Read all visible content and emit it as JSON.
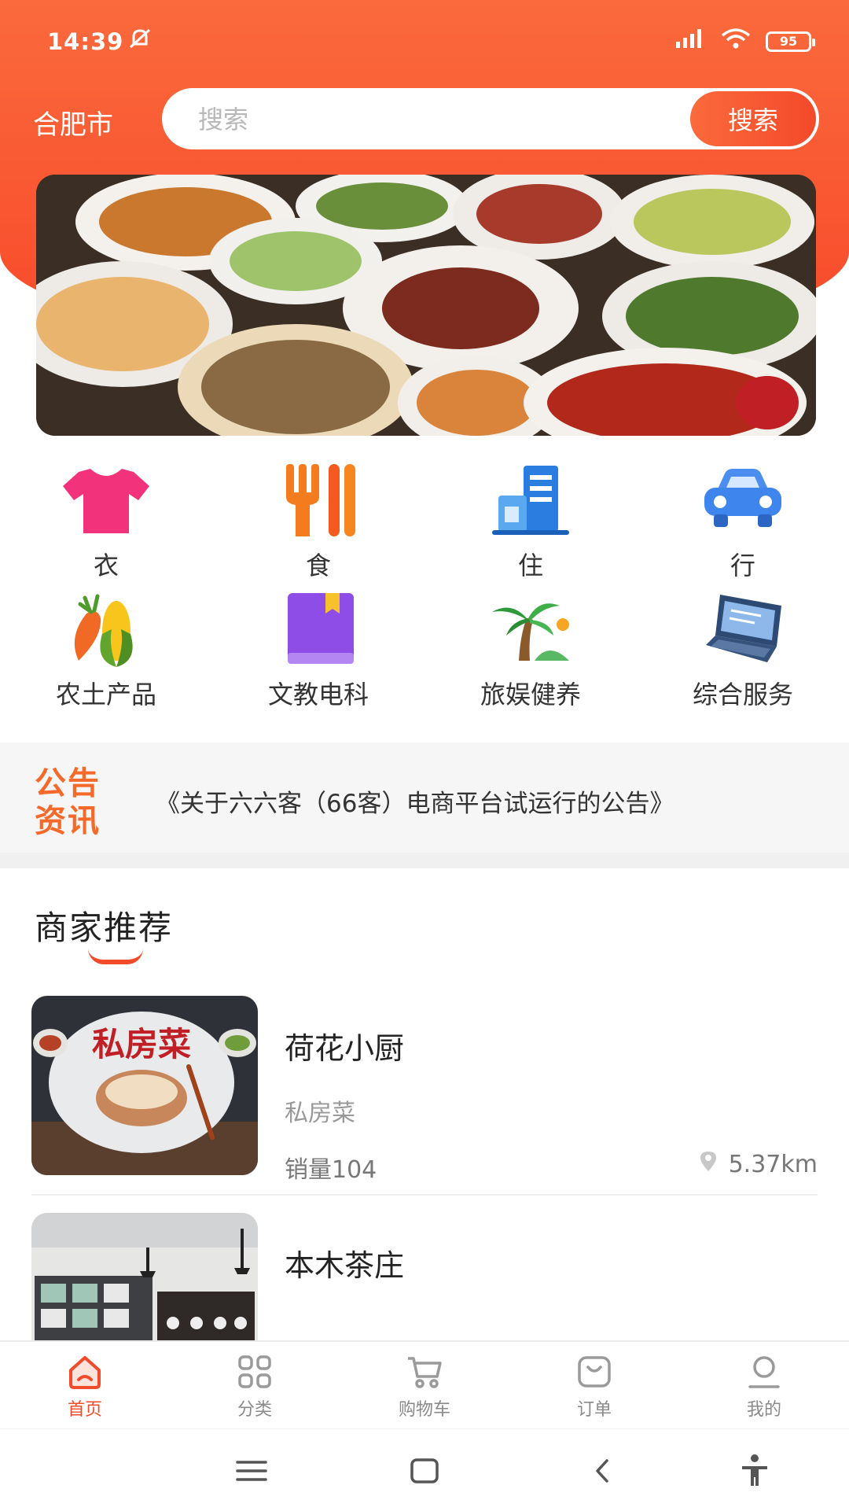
{
  "status_bar": {
    "time": "14:39",
    "battery": "95"
  },
  "header": {
    "city": "合肥市",
    "search_placeholder": "搜索",
    "search_button": "搜索"
  },
  "categories": [
    {
      "label": "衣",
      "icon": "tshirt-icon"
    },
    {
      "label": "食",
      "icon": "utensils-icon"
    },
    {
      "label": "住",
      "icon": "building-icon"
    },
    {
      "label": "行",
      "icon": "car-icon"
    },
    {
      "label": "农土产品",
      "icon": "vegetables-icon"
    },
    {
      "label": "文教电科",
      "icon": "book-icon"
    },
    {
      "label": "旅娱健养",
      "icon": "palm-tree-icon"
    },
    {
      "label": "综合服务",
      "icon": "laptop-icon"
    }
  ],
  "notice": {
    "tag_line1": "公告",
    "tag_line2": "资讯",
    "text": "《关于六六客（66客）电商平台试运行的公告》"
  },
  "merchants": {
    "title": "商家推荐",
    "items": [
      {
        "name": "荷花小厨",
        "type": "私房菜",
        "sales": "销量104",
        "distance": "5.37km",
        "thumb_text": "私房菜"
      },
      {
        "name": "本木茶庄",
        "type": "",
        "sales": "",
        "distance": ""
      }
    ]
  },
  "tabbar": [
    {
      "label": "首页",
      "icon": "home-icon",
      "active": true
    },
    {
      "label": "分类",
      "icon": "category-icon",
      "active": false
    },
    {
      "label": "购物车",
      "icon": "cart-icon",
      "active": false
    },
    {
      "label": "订单",
      "icon": "order-icon",
      "active": false
    },
    {
      "label": "我的",
      "icon": "profile-icon",
      "active": false
    }
  ],
  "colors": {
    "accent": "#f24b2b",
    "hero_top": "#fa6a3c",
    "notice_tag": "#f56a2a"
  }
}
